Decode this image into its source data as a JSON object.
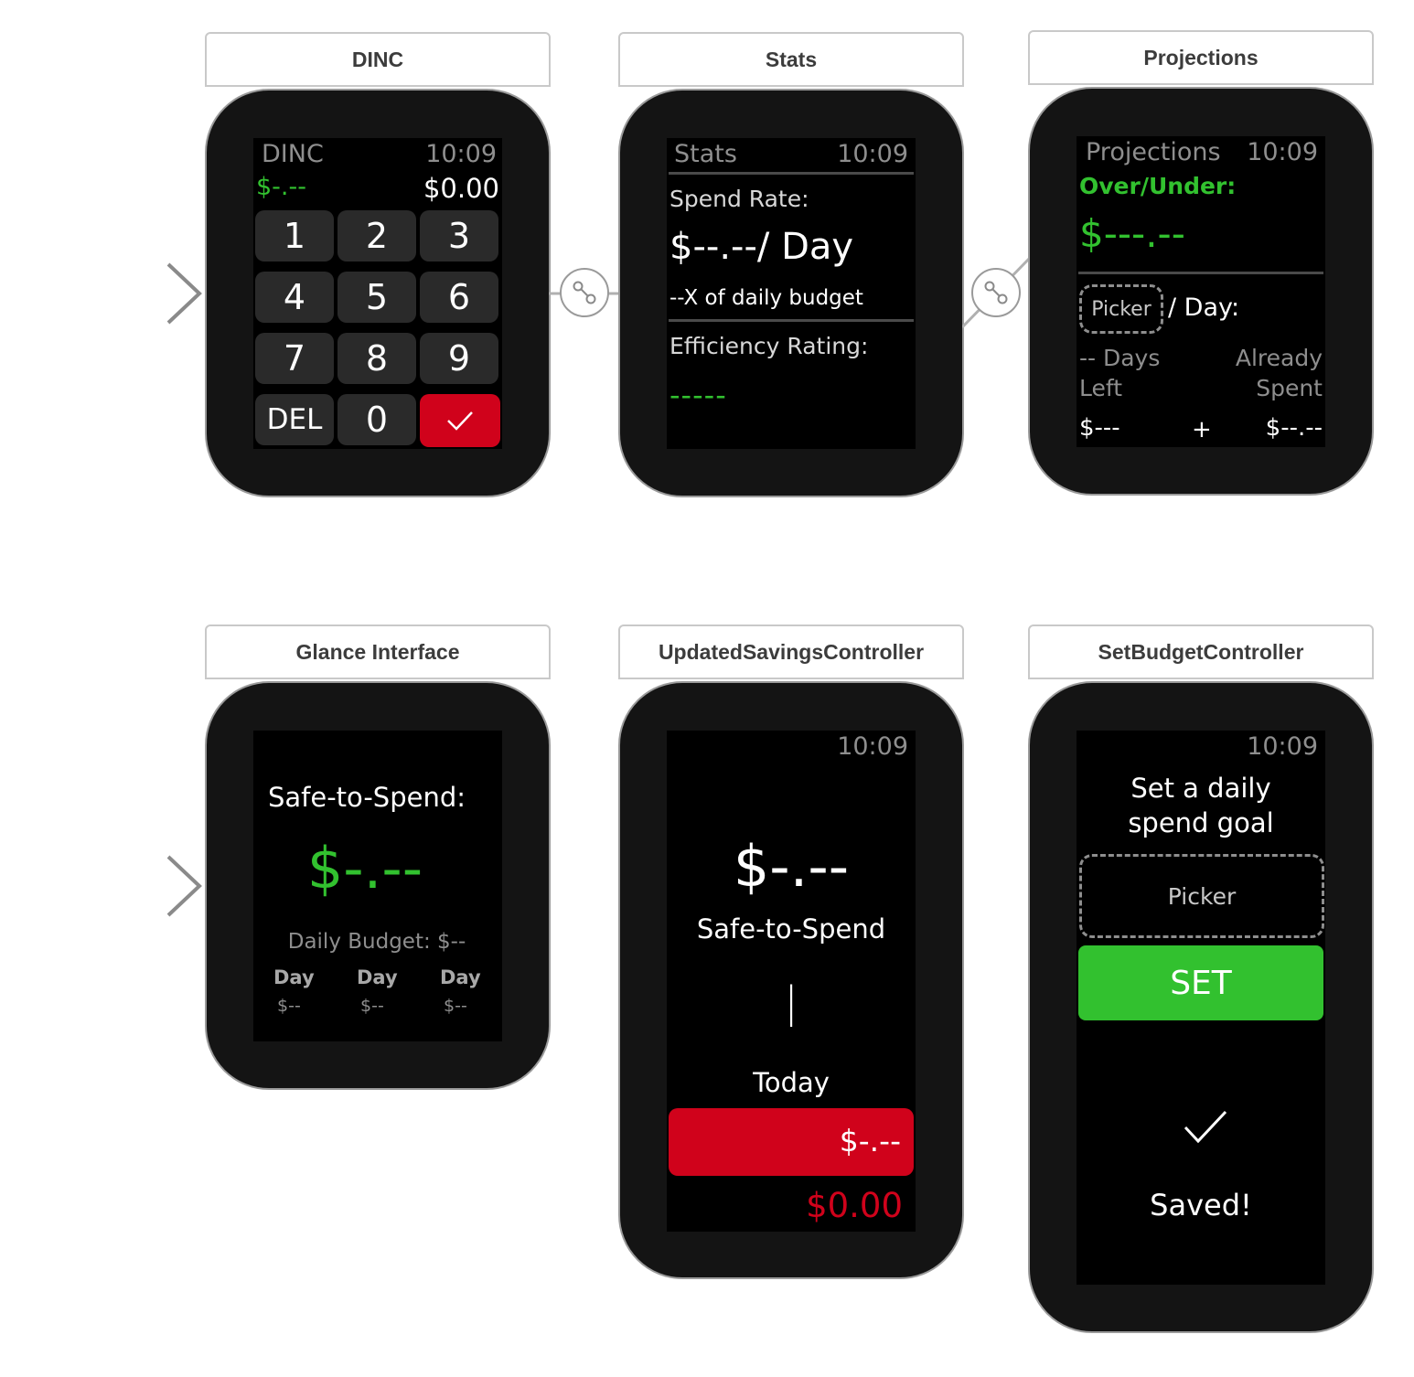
{
  "scenes": {
    "dinc": {
      "header": "DINC",
      "title": "DINC",
      "time": "10:09",
      "left_value": "$-.--",
      "right_value": "$0.00",
      "keys": [
        "1",
        "2",
        "3",
        "4",
        "5",
        "6",
        "7",
        "8",
        "9",
        "DEL",
        "0"
      ],
      "confirm_icon": "checkmark-icon"
    },
    "stats": {
      "header": "Stats",
      "title": "Stats",
      "time": "10:09",
      "spend_rate_label": "Spend Rate:",
      "spend_rate_value": "$--.--/ Day",
      "budget_ratio": "--X of daily budget",
      "efficiency_label": "Efficiency Rating:",
      "efficiency_value": "-----"
    },
    "projections": {
      "header": "Projections",
      "title": "Projections",
      "time": "10:09",
      "over_under_label": "Over/Under:",
      "over_under_value": "$---.--",
      "picker_label": "Picker",
      "per_day": "/ Day:",
      "days_left_1": "-- Days",
      "days_left_2": "Left",
      "already_1": "Already",
      "already_2": "Spent",
      "left_amount": "$---",
      "plus": "+",
      "right_amount": "$--.--"
    },
    "glance": {
      "header": "Glance Interface",
      "safe_label": "Safe-to-Spend:",
      "safe_value": "$-.--",
      "daily_budget": "Daily Budget: $--",
      "days": [
        {
          "label": "Day",
          "value": "$--"
        },
        {
          "label": "Day",
          "value": "$--"
        },
        {
          "label": "Day",
          "value": "$--"
        }
      ]
    },
    "updated_savings": {
      "header": "UpdatedSavingsController",
      "time": "10:09",
      "amount": "$-.--",
      "safe_label": "Safe-to-Spend",
      "cursor": "|",
      "today_label": "Today",
      "today_button": "$-.--",
      "total": "$0.00"
    },
    "set_budget": {
      "header": "SetBudgetController",
      "time": "10:09",
      "prompt_1": "Set a daily",
      "prompt_2": "spend goal",
      "picker_label": "Picker",
      "set_button": "SET",
      "check_icon": "checkmark-icon",
      "saved_label": "Saved!"
    }
  },
  "colors": {
    "green": "#32c12f",
    "red": "#d0021b",
    "gray_text": "#8e8e8e",
    "bezel": "#141414"
  }
}
